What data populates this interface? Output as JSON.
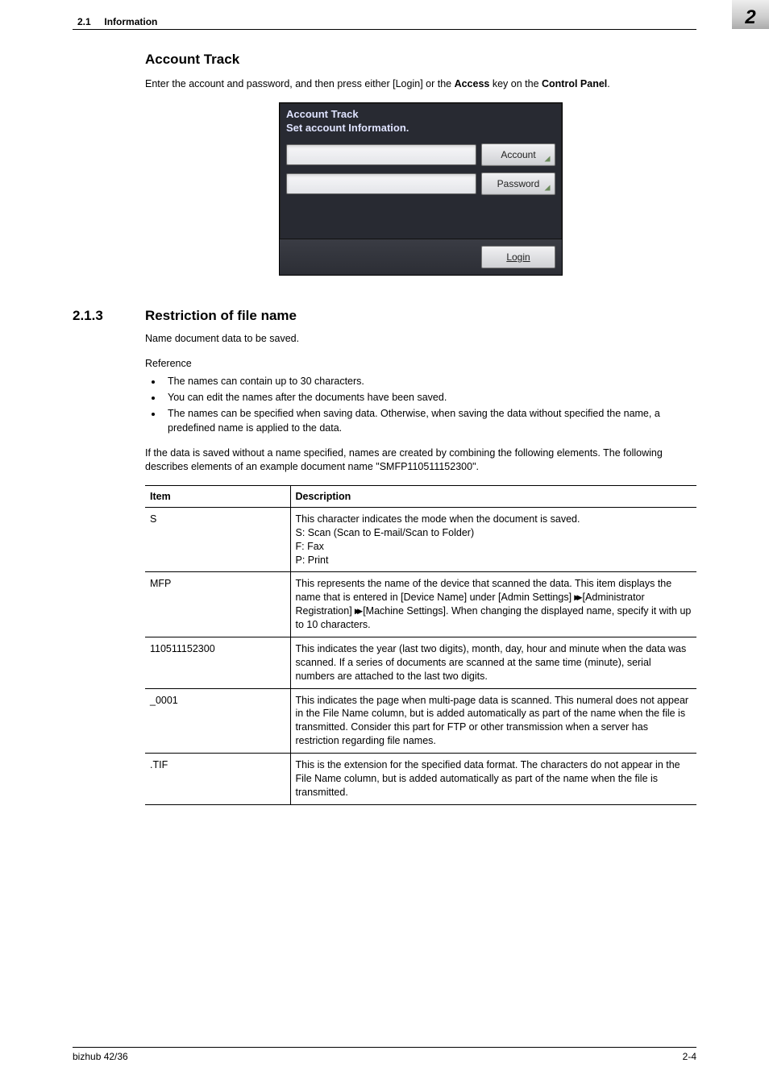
{
  "header": {
    "section_number": "2.1",
    "section_title": "Information",
    "chapter": "2"
  },
  "at": {
    "heading": "Account Track",
    "intro_pre": "Enter the account and password, and then press either [Login] or the ",
    "intro_bold1": "Access",
    "intro_mid": " key on the ",
    "intro_bold2": "Control Panel",
    "intro_post": "."
  },
  "screen": {
    "title": "Account Track",
    "subtitle": "Set account Information.",
    "account": "Account",
    "password": "Password",
    "login": "Login"
  },
  "sec213": {
    "number": "2.1.3",
    "title": "Restriction of file name",
    "p1": "Name document data to be saved.",
    "ref_label": "Reference",
    "bullets": [
      "The names can contain up to 30 characters.",
      "You can edit the names after the documents have been saved.",
      "The names can be specified when saving data. Otherwise, when saving the data without specified the name, a predefined name is applied to the data."
    ],
    "p2": "If the data is saved without a name specified, names are created by combining the following elements. The following describes elements of an example document name \"SMFP110511152300\"."
  },
  "table": {
    "h1": "Item",
    "h2": "Description",
    "rows": [
      {
        "item": "S",
        "desc": "This character indicates the mode when the document is saved.\nS: Scan (Scan to E-mail/Scan to Folder)\nF: Fax\nP: Print"
      },
      {
        "item": "MFP",
        "desc_pre": "This represents the name of the device that scanned the data. This item displays the name that is entered in [Device Name] under [Admin Settings] ",
        "desc_mid1": " [Administrator Registration] ",
        "desc_mid2": " [Machine Settings]. When changing the displayed name, specify it with up to 10 characters."
      },
      {
        "item": "110511152300",
        "desc": "This indicates the year (last two digits), month, day, hour and minute when the data was scanned. If a series of documents are scanned at the same time (minute), serial numbers are attached to the last two digits."
      },
      {
        "item": "_0001",
        "desc": "This indicates the page when multi-page data is scanned. This numeral does not appear in the File Name column, but is added automatically as part of the name when the file is transmitted. Consider this part for FTP or other transmission when a server has restriction regarding file names."
      },
      {
        "item": ".TIF",
        "desc": "This is the extension for the specified data format. The characters do not appear in the File Name column, but is added automatically as part of the name when the file is transmitted."
      }
    ]
  },
  "chart_data": {
    "type": "table",
    "title": "Document name elements for example \"SMFP110511152300\"",
    "columns": [
      "Item",
      "Description"
    ],
    "rows": [
      [
        "S",
        "This character indicates the mode when the document is saved. S: Scan (Scan to E-mail/Scan to Folder); F: Fax; P: Print"
      ],
      [
        "MFP",
        "This represents the name of the device that scanned the data. This item displays the name that is entered in [Device Name] under [Admin Settings] ▸▸ [Administrator Registration] ▸▸ [Machine Settings]. When changing the displayed name, specify it with up to 10 characters."
      ],
      [
        "110511152300",
        "This indicates the year (last two digits), month, day, hour and minute when the data was scanned. If a series of documents are scanned at the same time (minute), serial numbers are attached to the last two digits."
      ],
      [
        "_0001",
        "This indicates the page when multi-page data is scanned. This numeral does not appear in the File Name column, but is added automatically as part of the name when the file is transmitted. Consider this part for FTP or other transmission when a server has restriction regarding file names."
      ],
      [
        ".TIF",
        "This is the extension for the specified data format. The characters do not appear in the File Name column, but is added automatically as part of the name when the file is transmitted."
      ]
    ]
  },
  "footer": {
    "left": "bizhub 42/36",
    "right": "2-4"
  }
}
